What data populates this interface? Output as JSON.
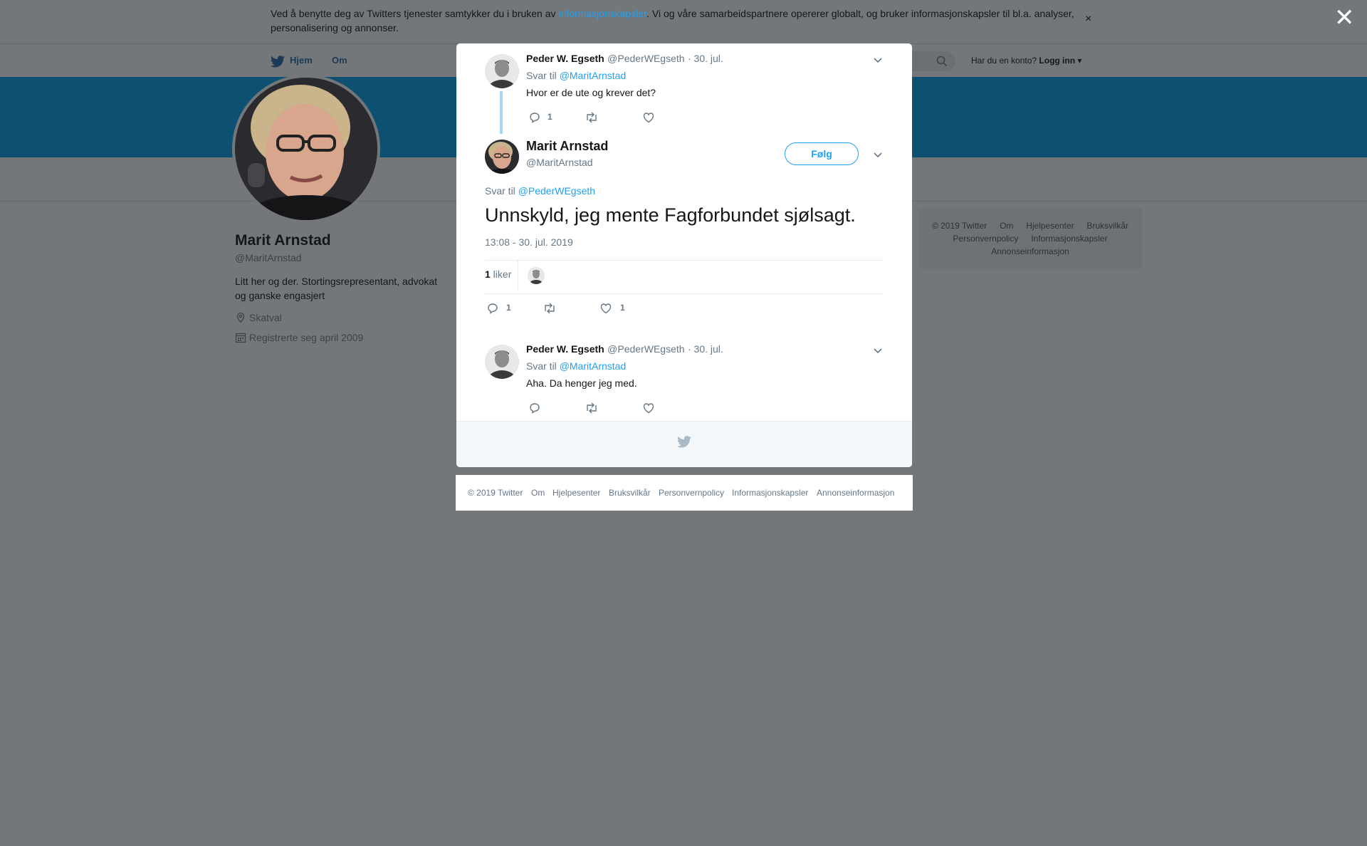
{
  "cookie": {
    "text_before": "Ved å benytte deg av Twitters tjenester samtykker du i bruken av ",
    "link": "informasjonskapsler",
    "text_after": ". Vi og våre samarbeidspartnere opererer globalt, og bruker informasjonskapsler til bl.a. analyser, personalisering og annonser.",
    "close": "×"
  },
  "overlay_close": "✕",
  "nav": {
    "home": "Hjem",
    "about": "Om",
    "account_prompt": "Har du en konto?",
    "login": "Logg inn"
  },
  "profile": {
    "name": "Marit Arnstad",
    "handle": "@MaritArnstad",
    "bio": "Litt her og der. Stortingsrepresentant, advokat og ganske engasjert",
    "location": "Skatval",
    "joined": "Registrerte seg april 2009"
  },
  "right_footer": {
    "line1": [
      "© 2019 Twitter",
      "Om",
      "Hjelpesenter",
      "Bruksvilkår"
    ],
    "line2": [
      "Personvernpolicy",
      "Informasjonskapsler"
    ],
    "line3": [
      "Annonseinformasjon"
    ]
  },
  "tweets": {
    "prev": {
      "name": "Peder W. Egseth",
      "handle": "@PederWEgseth",
      "date": "· 30. jul.",
      "reply_prefix": "Svar til ",
      "reply_to": "@MaritArnstad",
      "text": "Hvor er de ute og krever det?",
      "reply_count": "1"
    },
    "main": {
      "name": "Marit Arnstad",
      "handle": "@MaritArnstad",
      "follow": "Følg",
      "reply_prefix": "Svar til ",
      "reply_to": "@PederWEgseth",
      "text": "Unnskyld, jeg mente Fagforbundet sjølsagt.",
      "timestamp": "13:08 - 30. jul. 2019",
      "likes_count": "1",
      "likes_label": " liker",
      "reply_count": "1",
      "like_count": "1"
    },
    "next": {
      "name": "Peder W. Egseth",
      "handle": "@PederWEgseth",
      "date": "· 30. jul.",
      "reply_prefix": "Svar til ",
      "reply_to": "@MaritArnstad",
      "text": "Aha. Da henger jeg med."
    }
  },
  "footer": [
    "© 2019 Twitter",
    "Om",
    "Hjelpesenter",
    "Bruksvilkår",
    "Personvernpolicy",
    "Informasjonskapsler",
    "Annonseinformasjon"
  ],
  "colors": {
    "accent": "#1da1f2",
    "dim_bg": "#737779",
    "banner": "#0e5072"
  },
  "icons": [
    "twitter-bird-icon",
    "search-icon",
    "location-icon",
    "calendar-icon",
    "reply-icon",
    "retweet-icon",
    "like-icon",
    "caret-down-icon",
    "close-icon"
  ]
}
